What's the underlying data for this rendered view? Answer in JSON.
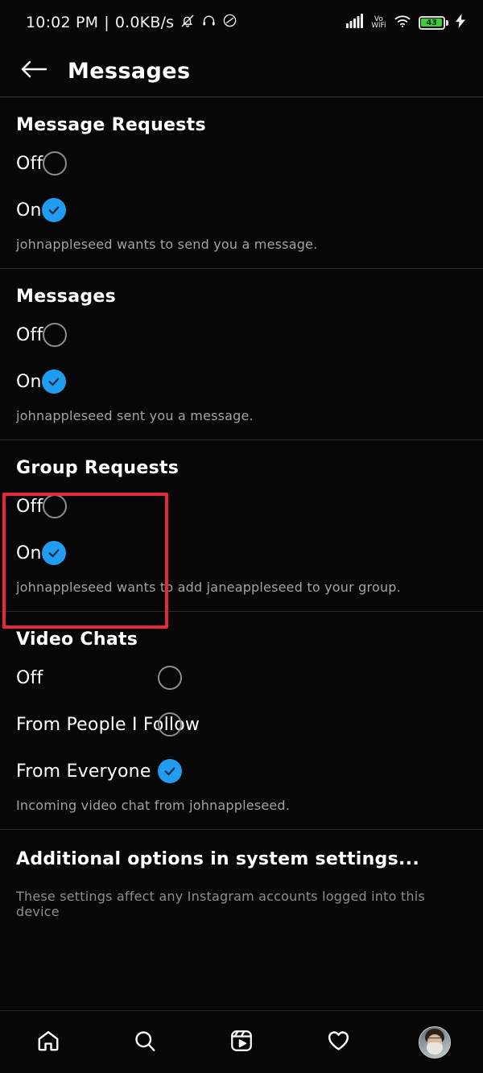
{
  "statusbar": {
    "time": "10:02 PM",
    "separator": "|",
    "network_speed": "0.0KB/s",
    "icons_left": [
      "bell-muted-icon",
      "headphone-icon",
      "dnd-icon"
    ],
    "icons_right": [
      "cellular-signal-icon",
      "volte-wifi-icon",
      "wifi-icon"
    ],
    "volte_line1": "Vo",
    "volte_line2": "WiFi",
    "battery_level": "43",
    "battery_color": "#37d13a",
    "charging": true
  },
  "header": {
    "back_icon": "arrow-left-icon",
    "title": "Messages"
  },
  "colors": {
    "accent_blue": "#209cf0",
    "highlight_red": "#e5293b",
    "radio_off_border": "#8e8e8e",
    "helper_text": "#a3a3a3",
    "background": "#070707"
  },
  "sections": [
    {
      "title": "Message Requests",
      "layout": "inline",
      "options": [
        {
          "label": "Off",
          "selected": false
        },
        {
          "label": "On",
          "selected": true
        }
      ],
      "helper": "johnappleseed wants to send you a message.",
      "highlighted": false
    },
    {
      "title": "Messages",
      "layout": "inline",
      "options": [
        {
          "label": "Off",
          "selected": false
        },
        {
          "label": "On",
          "selected": true
        }
      ],
      "helper": "johnappleseed sent you a message.",
      "highlighted": false
    },
    {
      "title": "Group Requests",
      "layout": "inline",
      "options": [
        {
          "label": "Off",
          "selected": false
        },
        {
          "label": "On",
          "selected": true
        }
      ],
      "helper": "johnappleseed wants to add janeappleseed to your group.",
      "highlighted": true
    },
    {
      "title": "Video Chats",
      "layout": "aligned",
      "options": [
        {
          "label": "Off",
          "selected": false
        },
        {
          "label": "From People I Follow",
          "selected": false
        },
        {
          "label": "From Everyone",
          "selected": true
        }
      ],
      "helper": "Incoming video chat from johnappleseed.",
      "highlighted": false
    }
  ],
  "extra": {
    "title": "Additional options in system settings...",
    "subtitle": "These settings affect any Instagram accounts logged into this device"
  },
  "bottom_nav": {
    "items": [
      {
        "icon": "home-icon",
        "label": "Home"
      },
      {
        "icon": "search-icon",
        "label": "Search"
      },
      {
        "icon": "reels-icon",
        "label": "Reels"
      },
      {
        "icon": "heart-icon",
        "label": "Activity"
      },
      {
        "icon": "profile-avatar-icon",
        "label": "Profile"
      }
    ]
  }
}
